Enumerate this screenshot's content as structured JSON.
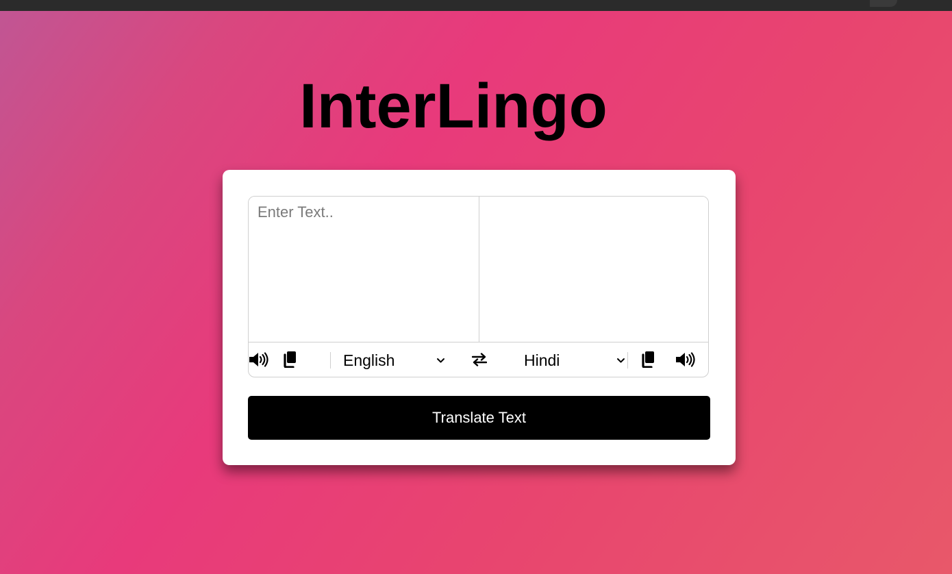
{
  "app": {
    "title": "InterLingo"
  },
  "input": {
    "from_placeholder": "Enter Text..",
    "from_value": "",
    "to_value": ""
  },
  "languages": {
    "from_selected": "English",
    "to_selected": "Hindi"
  },
  "controls": {
    "left_icons": [
      "volume-icon",
      "copy-icon"
    ],
    "exchange_icon": "exchange-icon",
    "right_icons": [
      "copy-icon",
      "volume-icon"
    ]
  },
  "actions": {
    "translate_label": "Translate Text"
  },
  "colors": {
    "background_gradient": [
      "#c05694",
      "#e83a7b",
      "#e8586a"
    ],
    "card": "#ffffff",
    "button": "#000000",
    "button_text": "#ffffff",
    "border": "#cfcfcf"
  }
}
